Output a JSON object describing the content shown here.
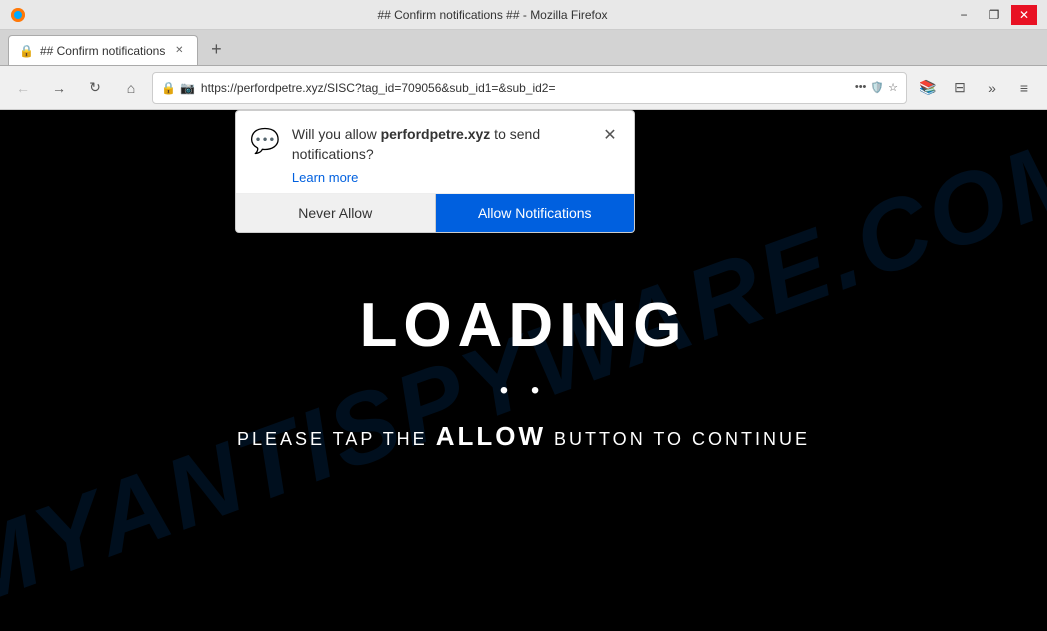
{
  "titlebar": {
    "title": "## Confirm notifications ## - Mozilla Firefox",
    "minimize_label": "−",
    "restore_label": "❐",
    "close_label": "✕"
  },
  "tabbar": {
    "tab_title": "## Confirm notifications",
    "new_tab_label": "+"
  },
  "navbar": {
    "back_label": "←",
    "forward_label": "→",
    "reload_label": "↻",
    "home_label": "⌂",
    "url": "https://perfordpetre.xyz/SISC?tag_id=709056&sub_id1=&sub_id2=",
    "more_label": "•••",
    "bookmark_label": "☆",
    "library_label": "📚",
    "synced_tabs_label": "⊟",
    "more_tools_label": "»",
    "menu_label": "≡"
  },
  "popup": {
    "question_prefix": "Will you allow ",
    "domain": "perfordpetre.xyz",
    "question_suffix": " to send notifications?",
    "learn_more_label": "Learn more",
    "close_label": "✕",
    "never_allow_label": "Never Allow",
    "allow_label": "Allow Notifications"
  },
  "page": {
    "watermark": "MYANTISPYWARE.COM",
    "loading_text": "LOADING",
    "loading_dots": "• •",
    "tap_text_prefix": "PLEASE TAP THE ",
    "allow_big": "ALLOW",
    "tap_text_suffix": " BUTTON TO CONTINUE"
  }
}
